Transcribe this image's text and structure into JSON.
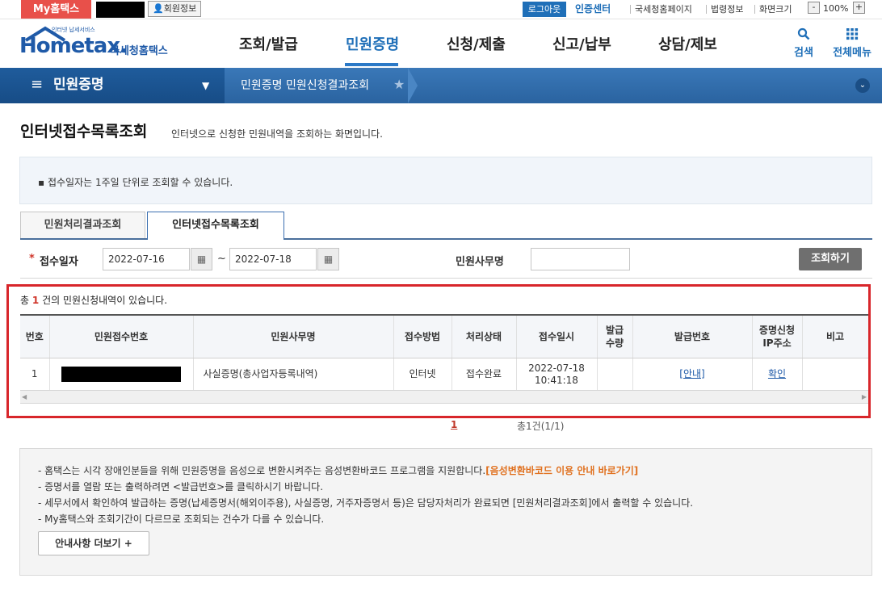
{
  "topbar": {
    "my_hometax": "My홈택스",
    "member_info": "회원정보",
    "logout": "로그아웃",
    "auth_center": "인증센터",
    "nts_home": "국세청홈페이지",
    "law_info": "법령정보",
    "screen_size": "화면크기",
    "zoom_out": "-",
    "zoom_value": "100%",
    "zoom_in": "+"
  },
  "header": {
    "logo_small": "인터넷 납세서비스",
    "logo_main": "Hometax.",
    "logo_sub": "국세청홈택스",
    "nav": [
      "조회/발급",
      "민원증명",
      "신청/제출",
      "신고/납부",
      "상담/제보"
    ],
    "search": "검색",
    "all_menu": "전체메뉴"
  },
  "bluebar": {
    "menu_icon": "≡",
    "section": "민원증명",
    "dropdown": "▼",
    "breadcrumb": "민원증명 민원신청결과조회",
    "star": "★",
    "collapse": "⌄"
  },
  "page": {
    "title": "인터넷접수목록조회",
    "description": "인터넷으로 신청한 민원내역을 조회하는 화면입니다."
  },
  "notice": "▪ 접수일자는 1주일 단위로 조회할 수 있습니다.",
  "tabs": [
    "민원처리결과조회",
    "인터넷접수목록조회"
  ],
  "search": {
    "required_mark": "*",
    "date_label": "접수일자",
    "date_from": "2022-07-16",
    "date_to": "2022-07-18",
    "tilde": "~",
    "office_label": "민원사무명",
    "office_value": "",
    "button": "조회하기"
  },
  "result": {
    "prefix": "총",
    "count": "1",
    "suffix": "건의 민원신청내역이 있습니다."
  },
  "table": {
    "headers": [
      "번호",
      "민원접수번호",
      "민원사무명",
      "접수방법",
      "처리상태",
      "접수일시",
      "발급\n수량",
      "발급번호",
      "증명신청\nIP주소",
      "비고"
    ],
    "rows": [
      {
        "no": "1",
        "office": "사실증명(총사업자등록내역)",
        "method": "인터넷",
        "status": "접수완료",
        "date": "2022-07-18",
        "time": "10:41:18",
        "qty": "",
        "issue_no": "[안내]",
        "ip": "확인",
        "note": ""
      }
    ]
  },
  "pagination": {
    "current": "1",
    "total": "총1건(1/1)"
  },
  "info": {
    "line1_text": "- 홈택스는 시각 장애인분들을 위해 민원증명을 음성으로 변환시켜주는 음성변환바코드 프로그램을 지원합니다.",
    "line1_link": "[음성변환바코드 이용 안내 바로가기]",
    "line2": "- 증명서를 열람 또는 출력하려면 <발급번호>를 클릭하시기 바랍니다.",
    "line3": "- 세무서에서 확인하여 발급하는 증명(납세증명서(해외이주용), 사실증명, 거주자증명서 등)은 담당자처리가 완료되면 [민원처리결과조회]에서 출력할 수 있습니다.",
    "line4": "- My홈택스와 조회기간이 다르므로 조회되는 건수가 다를 수 있습니다.",
    "more": "안내사항 더보기 +"
  }
}
